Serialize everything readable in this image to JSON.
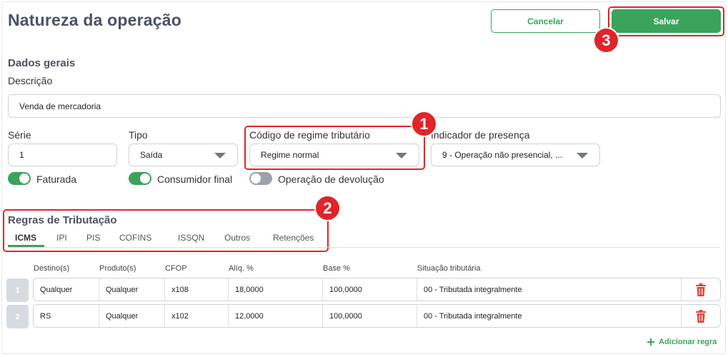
{
  "page": {
    "title": "Natureza da operação"
  },
  "header": {
    "cancel_label": "Cancelar",
    "save_label": "Salvar"
  },
  "annotations": {
    "one": "1",
    "two": "2",
    "three": "3"
  },
  "general": {
    "section_title": "Dados gerais",
    "description_label": "Descrição",
    "description_value": "Venda de mercadoria",
    "serie_label": "Série",
    "serie_value": "1",
    "tipo_label": "Tipo",
    "tipo_value": "Saída",
    "regime_label": "Código de regime tributário",
    "regime_value": "Regime normal",
    "presenca_label": "Indicador de presença",
    "presenca_value": "9 - Operação não presencial, ..."
  },
  "toggles": [
    {
      "label": "Faturada",
      "on": true
    },
    {
      "label": "Consumidor final",
      "on": true
    },
    {
      "label": "Operação de devolução",
      "on": false
    }
  ],
  "rules": {
    "section_title": "Regras de Tributação",
    "tabs": [
      "ICMS",
      "IPI",
      "PIS",
      "COFINS",
      "ISSQN",
      "Outros",
      "Retenções"
    ],
    "active_tab": "ICMS",
    "columns": [
      "Destino(s)",
      "Produto(s)",
      "CFOP",
      "Alíq. %",
      "Base %",
      "Situação tributária"
    ],
    "rows": [
      {
        "num": "1",
        "destino": "Qualquer",
        "produto": "Qualquer",
        "cfop": "x108",
        "aliq": "18,0000",
        "base": "100,0000",
        "situacao": "00 - Tributada integralmente"
      },
      {
        "num": "2",
        "destino": "RS",
        "produto": "Qualquer",
        "cfop": "x102",
        "aliq": "12,0000",
        "base": "100,0000",
        "situacao": "00 - Tributada integralmente"
      }
    ],
    "add_rule_label": "Adicionar regra"
  },
  "colors": {
    "accent": "#3aa35c",
    "highlight": "#e0242a",
    "danger": "#e0443e"
  },
  "icons": {
    "dropdown": "chevron-down-icon",
    "delete": "trash-icon",
    "add": "plus-icon"
  }
}
